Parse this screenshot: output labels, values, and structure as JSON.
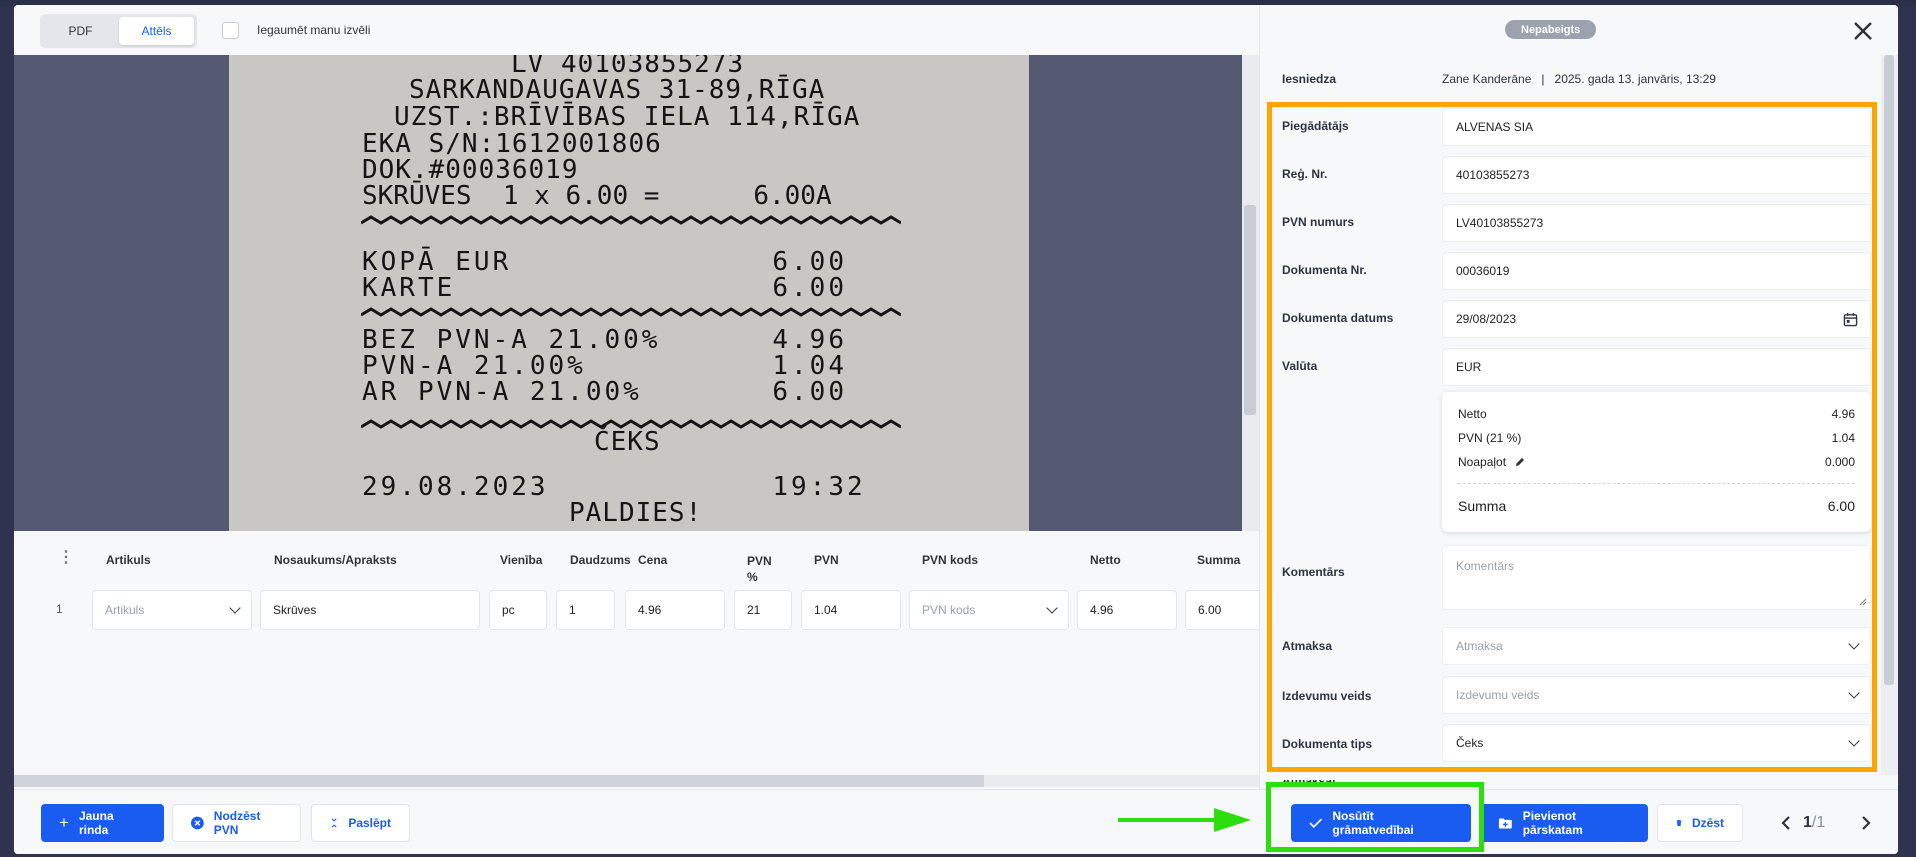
{
  "view_toggle": {
    "pdf": "PDF",
    "image": "Attēls"
  },
  "remember_choice": "Iegaumēt manu izvēli",
  "receipt_lines": [
    "LV 40103855273",
    "SARKANDAUGAVAS 31-89,RĪGA",
    "UZST.:BRĪVĪBAS IELA 114,RĪGA",
    "EKA S/N:1612001806",
    "DOK.#00036019",
    "SKRŪVES  1 x 6.00 =      6.00A",
    "KOPĀ EUR              6.00",
    "KARTE                 6.00",
    "BEZ PVN-A 21.00%      4.96",
    "PVN-A 21.00%          1.04",
    "AR PVN-A 21.00%       6.00",
    "ČEKS",
    "29.08.2023            19:32",
    "PALDIES!"
  ],
  "table": {
    "headers": [
      "Artikuls",
      "Nosaukums/Apraksts",
      "Vienība",
      "Daudzums",
      "Cena",
      "PVN %",
      "PVN",
      "PVN kods",
      "Netto",
      "Summa"
    ],
    "row": {
      "index": "1",
      "article_placeholder": "Artikuls",
      "name": "Skrūves",
      "unit": "pc",
      "quantity": "1",
      "price": "4.96",
      "vat_percent": "21",
      "vat": "1.04",
      "vat_code_placeholder": "PVN kods",
      "net": "4.96",
      "sum": "6.00"
    }
  },
  "bottom_buttons": {
    "new_row": "Jauna rinda",
    "remove_vat": "Nodzēst PVN",
    "hide": "Paslēpt",
    "send": "Nosūtīt grāmatvedībai",
    "add_report": "Pievienot pārskatam",
    "delete": "Dzēst",
    "page_current": "1",
    "page_total": "/1"
  },
  "right": {
    "status": "Nepabeigts",
    "submitted_label": "Iesniedza",
    "submitted_value": "Zane Kanderāne   |   2025. gada 13. janvāris, 13:29",
    "fields": {
      "supplier_label": "Piegādātājs",
      "supplier": "ALVENAS SIA",
      "reg_label": "Reģ. Nr.",
      "reg": "40103855273",
      "vat_label": "PVN numurs",
      "vat": "LV40103855273",
      "doc_no_label": "Dokumenta Nr.",
      "doc_no": "00036019",
      "doc_date_label": "Dokumenta datums",
      "doc_date": "29/08/2023",
      "currency_label": "Valūta",
      "currency": "EUR",
      "comment_label": "Komentārs",
      "comment_placeholder": "Komentārs",
      "payment_label": "Atmaksa",
      "payment_placeholder": "Atmaksa",
      "expense_label": "Izdevumu veids",
      "expense_placeholder": "Izdevumu veids",
      "doc_type_label": "Dokumenta tips",
      "doc_type": "Čeks"
    },
    "summary": {
      "net_label": "Netto",
      "net": "4.96",
      "vat_label": "PVN (21 %)",
      "vat": "1.04",
      "round_label": "Noapaļot",
      "round": "0.000",
      "total_label": "Summa",
      "total": "6.00"
    },
    "cut_off_label": "Atmaksāt"
  },
  "colors": {
    "primary": "#1a5cf0",
    "highlight_orange": "#ffa500",
    "highlight_green": "#2dde0f",
    "badge": "#9ca3ae"
  }
}
